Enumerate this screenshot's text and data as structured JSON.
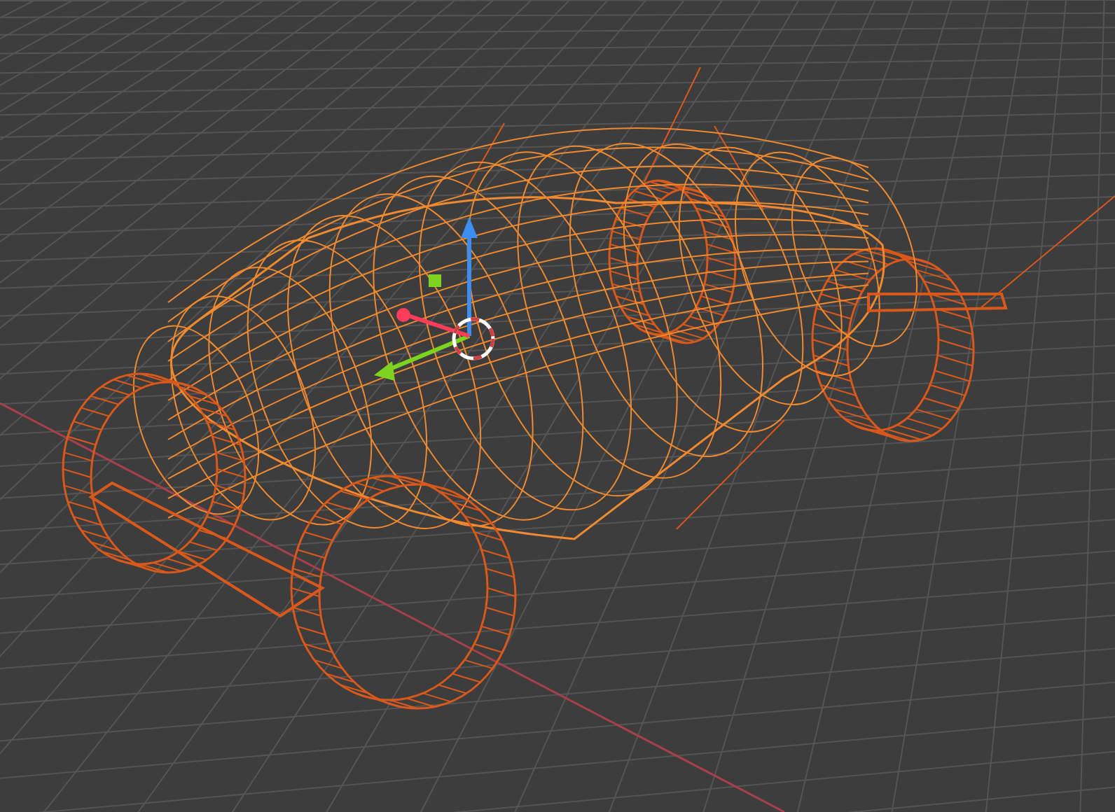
{
  "viewport": {
    "grid": true,
    "x_axis": true,
    "gizmo": true,
    "cursor": true
  }
}
